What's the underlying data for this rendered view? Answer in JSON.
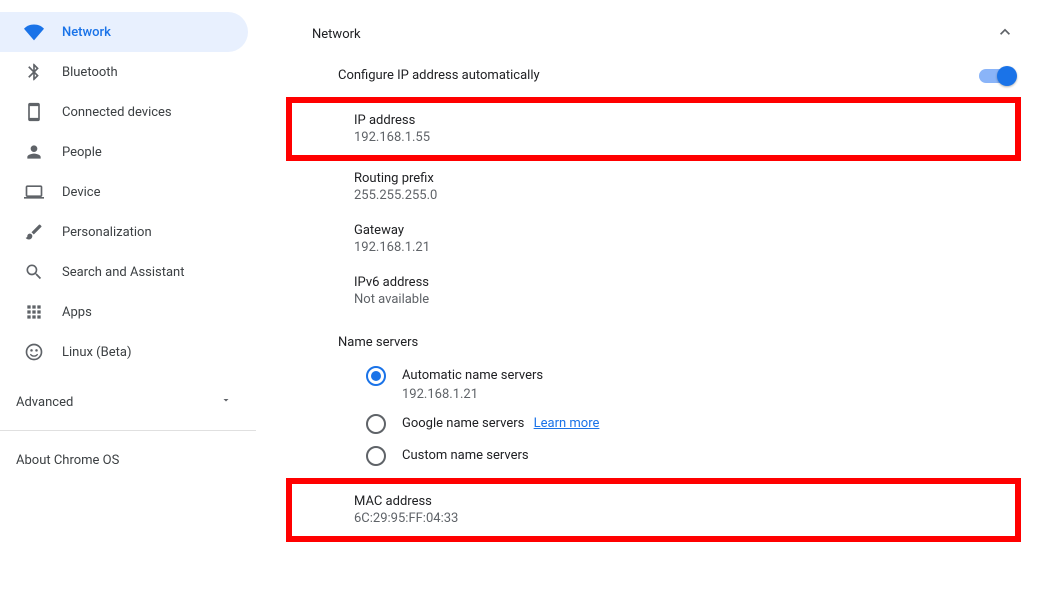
{
  "sidebar": {
    "items": [
      {
        "label": "Network",
        "icon": "wifi-icon",
        "active": true
      },
      {
        "label": "Bluetooth",
        "icon": "bluetooth-icon"
      },
      {
        "label": "Connected devices",
        "icon": "device-icon"
      },
      {
        "label": "People",
        "icon": "person-icon"
      },
      {
        "label": "Device",
        "icon": "laptop-icon"
      },
      {
        "label": "Personalization",
        "icon": "brush-icon"
      },
      {
        "label": "Search and Assistant",
        "icon": "search-icon"
      },
      {
        "label": "Apps",
        "icon": "apps-icon"
      },
      {
        "label": "Linux (Beta)",
        "icon": "linux-icon"
      }
    ],
    "advanced_label": "Advanced",
    "about_label": "About Chrome OS"
  },
  "section": {
    "title": "Network",
    "auto_ip_label": "Configure IP address automatically",
    "auto_ip_on": true
  },
  "fields": {
    "ip_label": "IP address",
    "ip_value": "192.168.1.55",
    "prefix_label": "Routing prefix",
    "prefix_value": "255.255.255.0",
    "gateway_label": "Gateway",
    "gateway_value": "192.168.1.21",
    "ipv6_label": "IPv6 address",
    "ipv6_value": "Not available",
    "mac_label": "MAC address",
    "mac_value": "6C:29:95:FF:04:33"
  },
  "nameservers": {
    "header": "Name servers",
    "options": {
      "automatic": {
        "label": "Automatic name servers",
        "value": "192.168.1.21"
      },
      "google": {
        "label": "Google name servers",
        "learn_more": "Learn more"
      },
      "custom": {
        "label": "Custom name servers"
      }
    }
  }
}
